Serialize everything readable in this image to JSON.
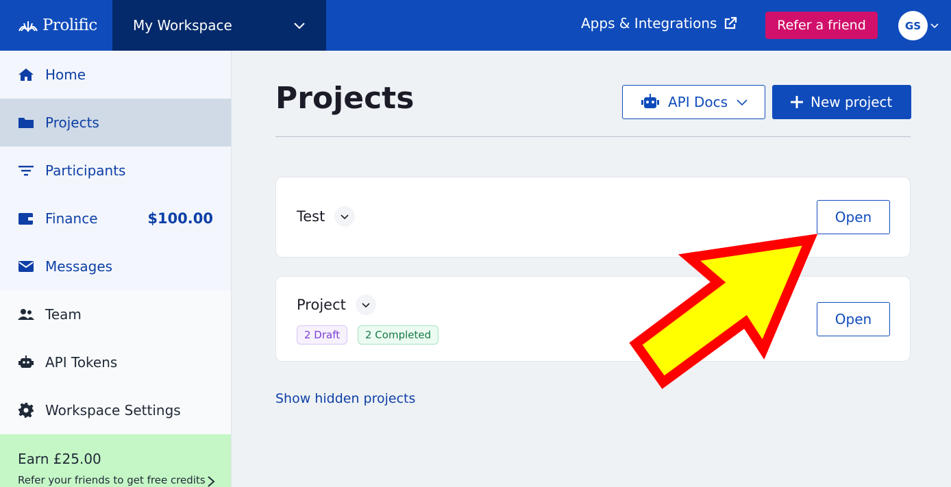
{
  "topbar": {
    "brand": "Prolific",
    "workspace": "My Workspace",
    "apps_link": "Apps & Integrations",
    "refer_button": "Refer a friend",
    "avatar_initials": "GS"
  },
  "sidebar": {
    "items": [
      {
        "label": "Home",
        "icon": "home-icon"
      },
      {
        "label": "Projects",
        "icon": "folder-icon"
      },
      {
        "label": "Participants",
        "icon": "filter-icon"
      },
      {
        "label": "Finance",
        "icon": "wallet-icon",
        "amount": "$100.00"
      },
      {
        "label": "Messages",
        "icon": "envelope-icon"
      },
      {
        "label": "Team",
        "icon": "users-icon"
      },
      {
        "label": "API Tokens",
        "icon": "robot-icon"
      },
      {
        "label": "Workspace Settings",
        "icon": "gear-icon"
      }
    ],
    "earn": {
      "title": "Earn £25.00",
      "subtitle": "Refer your friends to get free credits"
    }
  },
  "main": {
    "title": "Projects",
    "api_docs_button": "API Docs",
    "new_project_button": "New project",
    "projects": [
      {
        "name": "Test",
        "open_label": "Open"
      },
      {
        "name": "Project",
        "open_label": "Open",
        "badges": {
          "draft": "2 Draft",
          "completed": "2 Completed"
        }
      }
    ],
    "show_hidden": "Show hidden projects"
  },
  "colors": {
    "brand_blue": "#0f4bbb",
    "workspace_navy": "#042a6b",
    "refer_pink": "#d0106a",
    "earn_green": "#c5f7c6",
    "annotation_arrow_fill": "#ffff00",
    "annotation_arrow_stroke": "#ff0000"
  }
}
